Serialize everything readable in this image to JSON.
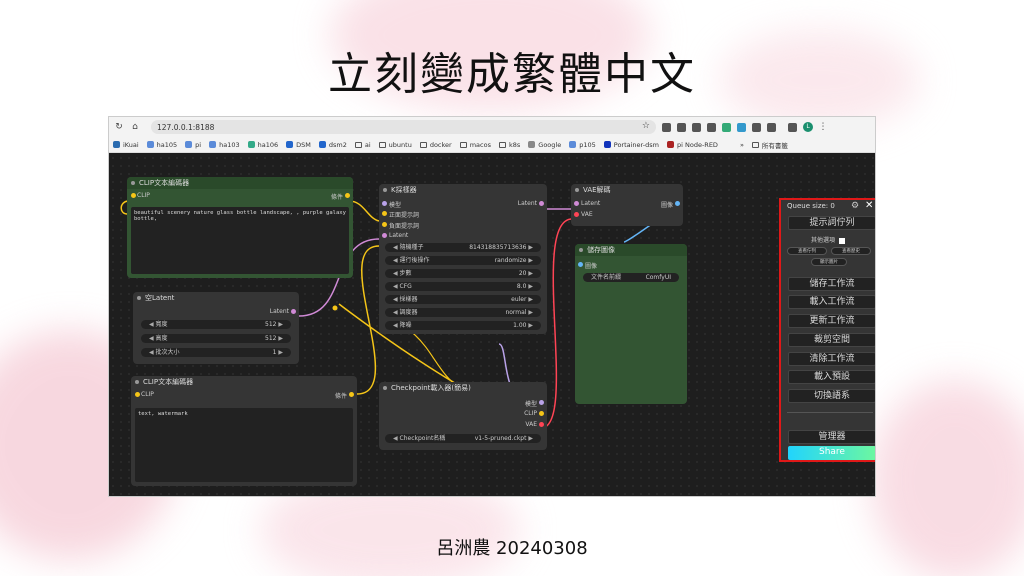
{
  "slide": {
    "title": "立刻變成繁體中文",
    "caption": "呂洲農 20240308"
  },
  "browser": {
    "url": "127.0.0.1:8188",
    "bookmarks": [
      "iKuai",
      "ha105",
      "pi",
      "ha103",
      "ha106",
      "DSM",
      "dsm2",
      "ai",
      "ubuntu",
      "docker",
      "macos",
      "k8s",
      "Google",
      "p105",
      "Portainer-dsm",
      "pi Node-RED"
    ],
    "all_bookmarks_label": "所有書籤",
    "avatar_letter": "L"
  },
  "nodes": {
    "clip_top": {
      "title": "CLIP文本編碼器",
      "in_clip": "CLIP",
      "out": "條件",
      "text": "beautiful scenery nature glass bottle landscape, , purple galaxy bottle,"
    },
    "empty_latent": {
      "title": "空Latent",
      "out": "Latent",
      "w_width": "寬度",
      "v_width": "512",
      "w_height": "高度",
      "v_height": "512",
      "w_batch": "批次大小",
      "v_batch": "1"
    },
    "clip_bottom": {
      "title": "CLIP文本編碼器",
      "in_clip": "CLIP",
      "out": "條件",
      "text": "text, watermark"
    },
    "ksampler": {
      "title": "K採樣器",
      "in_model": "模型",
      "in_pos": "正面提示詞",
      "in_neg": "負面提示詞",
      "in_latent": "Latent",
      "out": "Latent",
      "widgets": [
        {
          "label": "隨機種子",
          "value": "814318835713636"
        },
        {
          "label": "運行後操作",
          "value": "randomize"
        },
        {
          "label": "步數",
          "value": "20"
        },
        {
          "label": "CFG",
          "value": "8.0"
        },
        {
          "label": "採樣器",
          "value": "euler"
        },
        {
          "label": "調度器",
          "value": "normal"
        },
        {
          "label": "降噪",
          "value": "1.00"
        }
      ]
    },
    "vae_decode": {
      "title": "VAE解碼",
      "in_latent": "Latent",
      "in_vae": "VAE",
      "out": "圖像"
    },
    "save_image": {
      "title": "儲存圖像",
      "in_images": "圖像",
      "prefix_label": "文件名前綴",
      "prefix_value": "ComfyUI"
    },
    "checkpoint": {
      "title": "Checkpoint載入器(簡易)",
      "out_model": "模型",
      "out_clip": "CLIP",
      "out_vae": "VAE",
      "w_label": "Checkpoint名稱",
      "w_value": "v1-5-pruned.ckpt"
    }
  },
  "menu": {
    "queue_size": "Queue size: 0",
    "queue_prompt": "提示詞佇列",
    "extra_options": "其他選項",
    "view_queue": "查看佇列",
    "view_history": "查看歷史",
    "show_images": "顯示圖片",
    "save": "儲存工作流",
    "load": "載入工作流",
    "refresh": "更新工作流",
    "clipspace": "裁剪空間",
    "clear": "清除工作流",
    "load_default": "載入預設",
    "switch_locale": "切換語系",
    "manager": "管理器",
    "share": "Share"
  }
}
